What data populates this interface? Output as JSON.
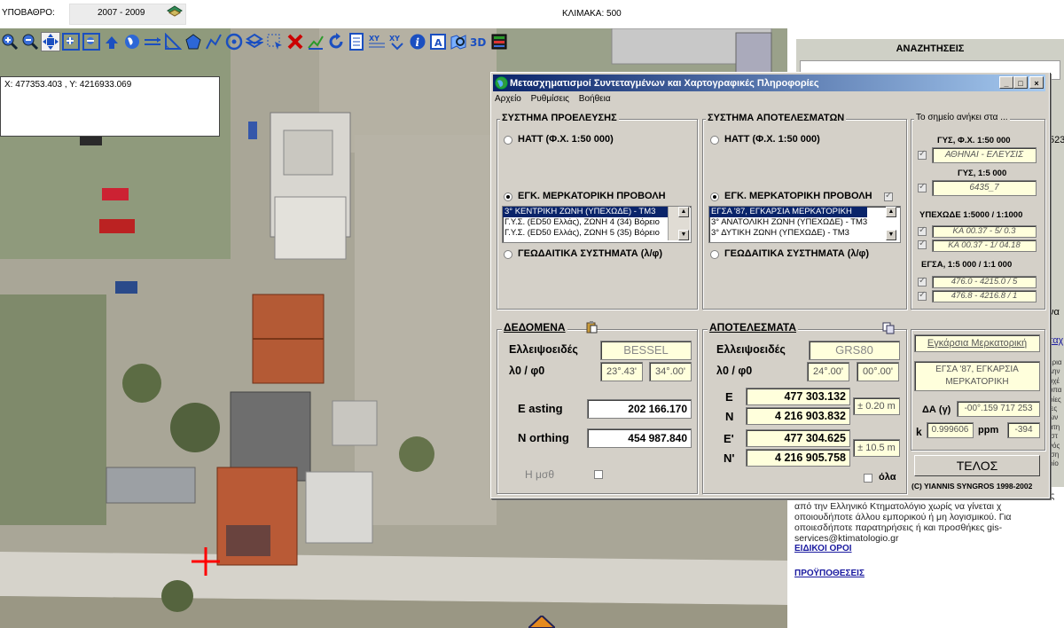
{
  "topbar": {
    "substrate_label": "ΥΠΟΒΑΘΡΟ:",
    "substrate_value": "2007 - 2009",
    "scale_label": "ΚΛΙΜΑΚΑ: 500"
  },
  "map": {
    "coordinates": "X: 477353.403 , Y: 4216933.069"
  },
  "toolbar": {
    "tools": [
      "zoom-in-icon",
      "zoom-out-icon",
      "pan-icon",
      "zoom-window-icon",
      "zoom-extent-icon",
      "previous-view-icon",
      "world-icon",
      "measure-distance-icon",
      "measure-area-icon",
      "polygon-icon",
      "polyline-icon",
      "circle-icon",
      "layers-select-icon",
      "select-icon",
      "clear-icon",
      "edit-icon",
      "refresh-icon",
      "report-icon",
      "coords-icon",
      "transform-icon",
      "info-icon",
      "print-icon",
      "search-map-icon",
      "3d-view-icon",
      "legend-icon"
    ],
    "label_3d": "3D"
  },
  "sidebar": {
    "search_header": "ΑΝΑΖΗΤΗΣΕΙΣ",
    "footer_text": "Ο ιστότοπος έχει δημιουργηθεί με λογισμικό που αναπτύ αρχής από την Ελληνικό Κτηματολόγιο χωρίς να γίνεται χ οποιουδήποτε άλλου εμπορικού ή μη λογισμικού. Για οποιεσδήποτε παρατηρήσεις ή και προσθήκες gis-services@ktimatologio.gr",
    "link_terms": "ΕΙΔΙΚΟΙ ΟΡΟΙ",
    "link_conditions": "ΠΡΟΫΠΟΘΕΣΕΙΣ",
    "edge_fragments": [
      "523",
      "να",
      "ταχ",
      "ερια",
      "λην",
      "οχέ",
      "οπα",
      "ρίες",
      "ιες",
      "ων",
      "ατη",
      "ιστ",
      "νός",
      "ιση",
      "ρίο"
    ]
  },
  "dialog": {
    "title": "Μετασχηματισμοί Συντεταγμένων και Χαρτογραφικές Πληροφορίες",
    "menu": [
      "Αρχείο",
      "Ρυθμίσεις",
      "Βοήθεια"
    ],
    "source": {
      "title": "ΣΥΣΤΗΜΑ ΠΡΟΕΛΕΥΣΗΣ",
      "opt_hatt": "ΗΑΤΤ (Φ.Χ. 1:50 000)",
      "opt_merc": "ΕΓΚ. ΜΕΡΚΑΤΟΡΙΚΗ ΠΡΟΒΟΛΗ",
      "opt_geod": "ΓΕΩΔΑΙΤΙΚΑ ΣΥΣΤΗΜΑΤΑ (λ/φ)",
      "list": [
        "3° ΚΕΝΤΡΙΚΗ ΖΩΝΗ (ΥΠΕΧΩΔΕ) - ΤΜ3",
        "Γ.Υ.Σ. (ED50 Ελλάς), ΖΩΝΗ 4 (34) Βόρειο",
        "Γ.Υ.Σ. (ED50 Ελλάς), ΖΩΝΗ 5 (35) Βόρειο"
      ]
    },
    "result": {
      "title": "ΣΥΣΤΗΜΑ ΑΠΟΤΕΛΕΣΜΑΤΩΝ",
      "opt_hatt": "ΗΑΤΤ (Φ.Χ. 1:50 000)",
      "opt_merc": "ΕΓΚ. ΜΕΡΚΑΤΟΡΙΚΗ ΠΡΟΒΟΛΗ",
      "opt_geod": "ΓΕΩΔΑΙΤΙΚΑ ΣΥΣΤΗΜΑΤΑ (λ/φ)",
      "list": [
        "ΕΓΣΑ '87, ΕΓΚΑΡΣΙΑ ΜΕΡΚΑΤΟΡΙΚΗ",
        "3° ΑΝΑΤΟΛΙΚΗ ΖΩΝΗ (ΥΠΕΧΩΔΕ) - ΤΜ3",
        "3° ΔΥΤΙΚΗ ΖΩΝΗ (ΥΠΕΧΩΔΕ) - ΤΜ3"
      ]
    },
    "point": {
      "title": "Το σημείο ανήκει στα ...",
      "h1": "ΓΥΣ, Φ.Χ. 1:50 000",
      "v1": "ΑΘΗΝΑΙ - ΕΛΕΥΣΙΣ",
      "h2": "ΓΥΣ, 1:5 000",
      "v2": "6435_7",
      "h3": "ΥΠΕΧΩΔΕ 1:5000 / 1:1000",
      "v3a": "ΚΑ 00.37 - 5/ 0.3",
      "v3b": "ΚΑ 00.37 - 1/ 04.18",
      "h4": "ΕΓΣΑ, 1:5 000 / 1:1 000",
      "v4a": "476.0 - 4215.0 / 5",
      "v4b": "476.8 - 4216.8 / 1"
    },
    "data": {
      "title": "ΔΕΔΟΜΕΝΑ",
      "ellipsoid_label": "Ελλειψοειδές",
      "ellipsoid": "BESSEL",
      "lf_label": "λ0 / φ0",
      "l0": "23°.43'",
      "f0": "34°.00'",
      "easting_label": "E asting",
      "easting": "202 166.170",
      "northing_label": "N orthing",
      "northing": "454 987.840",
      "h_label": "Η μσθ"
    },
    "results": {
      "title": "ΑΠΟΤΕΛΕΣΜΑΤΑ",
      "ellipsoid_label": "Ελλειψοειδές",
      "ellipsoid": "GRS80",
      "lf_label": "λ0 / φ0",
      "l0": "24°.00'",
      "f0": "00°.00'",
      "e_label": "E",
      "e": "477 303.132",
      "n_label": "N",
      "n": "4 216 903.832",
      "acc1": "± 0.20 m",
      "e2_label": "E'",
      "e2": "477 304.625",
      "n2_label": "N'",
      "n2": "4 216 905.758",
      "acc2": "± 10.5 m",
      "all_label": "όλα"
    },
    "proj": {
      "name": "Εγκάρσια Μερκατορική",
      "system": "ΕΓΣΑ '87, ΕΓΚΑΡΣΙΑ ΜΕΡΚΑΤΟΡΙΚΗ",
      "da_label": "ΔΑ (γ)",
      "da": "-00°.159 717 253",
      "k_label": "k",
      "k": "0.999606",
      "ppm_label": "ppm",
      "ppm": "-394"
    },
    "end_button": "ΤΕΛΟΣ",
    "copyright": "(C) YIANNIS SYNGROS 1998-2002"
  }
}
